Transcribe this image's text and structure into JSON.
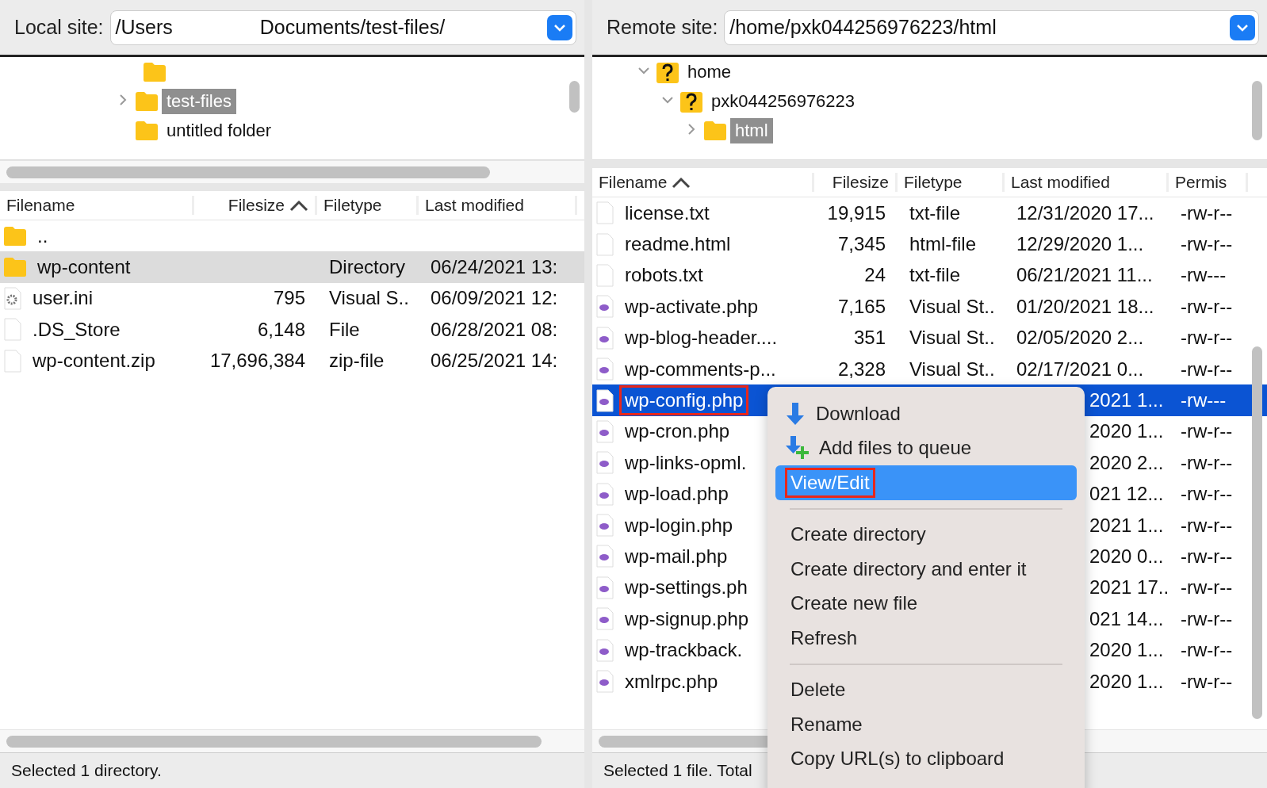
{
  "local": {
    "label": "Local site:",
    "path_start": "/Users",
    "path_end": "Documents/test-files/",
    "tree": [
      {
        "label": "test-files",
        "selected": true,
        "expanded": false
      },
      {
        "label": "untitled folder",
        "selected": false
      }
    ],
    "columns": [
      {
        "label": "Filename",
        "sorted": false
      },
      {
        "label": "Filesize",
        "sorted": true
      },
      {
        "label": "Filetype",
        "sorted": false
      },
      {
        "label": "Last modified",
        "sorted": false
      }
    ],
    "rows": [
      {
        "kind": "folder",
        "name": "..",
        "selected": false
      },
      {
        "kind": "folder",
        "name": "wp-content",
        "type": "Directory",
        "modified": "06/24/2021 13:",
        "selected": true
      },
      {
        "kind": "config",
        "name": "user.ini",
        "size": "795",
        "type": "Visual S..",
        "modified": "06/09/2021 12:",
        "selected": false
      },
      {
        "kind": "file",
        "name": ".DS_Store",
        "size": "6,148",
        "type": "File",
        "modified": "06/28/2021 08:",
        "selected": false
      },
      {
        "kind": "file",
        "name": "wp-content.zip",
        "size": "17,696,384",
        "type": "zip-file",
        "modified": "06/25/2021 14:",
        "selected": false
      }
    ],
    "status": "Selected 1 directory."
  },
  "remote": {
    "label": "Remote site:",
    "path": "/home/pxk044256976223/html",
    "tree": [
      {
        "label": "home",
        "kind": "unknown",
        "selected": false,
        "expanded": true,
        "children": [
          {
            "label": "pxk044256976223",
            "kind": "unknown",
            "selected": false,
            "expanded": true,
            "children": [
              {
                "label": "html",
                "selected": true,
                "expanded": false
              }
            ]
          }
        ]
      }
    ],
    "columns": [
      {
        "label": "Filename",
        "sorted": true
      },
      {
        "label": "Filesize",
        "sorted": false
      },
      {
        "label": "Filetype",
        "sorted": false
      },
      {
        "label": "Last modified",
        "sorted": false
      },
      {
        "label": "Permis",
        "sorted": false
      }
    ],
    "rows": [
      {
        "kind": "file",
        "name": "license.txt",
        "size": "19,915",
        "type": "txt-file",
        "modified": "12/31/2020 17...",
        "permissions": "-rw-r--",
        "selected": false,
        "highlighted": false
      },
      {
        "kind": "file",
        "name": "readme.html",
        "size": "7,345",
        "type": "html-file",
        "modified": "12/29/2020 1...",
        "permissions": "-rw-r--",
        "selected": false,
        "highlighted": false
      },
      {
        "kind": "file",
        "name": "robots.txt",
        "size": "24",
        "type": "txt-file",
        "modified": "06/21/2021 11...",
        "permissions": "-rw---",
        "selected": false,
        "highlighted": false
      },
      {
        "kind": "php",
        "name": "wp-activate.php",
        "size": "7,165",
        "type": "Visual St..",
        "modified": "01/20/2021 18...",
        "permissions": "-rw-r--",
        "selected": false,
        "highlighted": false
      },
      {
        "kind": "php",
        "name": "wp-blog-header....",
        "size": "351",
        "type": "Visual St..",
        "modified": "02/05/2020 2...",
        "permissions": "-rw-r--",
        "selected": false,
        "highlighted": false
      },
      {
        "kind": "php",
        "name": "wp-comments-p...",
        "size": "2,328",
        "type": "Visual St..",
        "modified": "02/17/2021 0...",
        "permissions": "-rw-r--",
        "selected": false,
        "highlighted": false
      },
      {
        "kind": "php",
        "name": "wp-config.php",
        "modified": "2021 1...",
        "permissions": "-rw---",
        "selected": true,
        "highlighted": true
      },
      {
        "kind": "php",
        "name": "wp-cron.php",
        "modified": "2020 1...",
        "permissions": "-rw-r--",
        "selected": false,
        "highlighted": false
      },
      {
        "kind": "php",
        "name": "wp-links-opml.",
        "modified": "2020 2...",
        "permissions": "-rw-r--",
        "selected": false,
        "highlighted": false
      },
      {
        "kind": "php",
        "name": "wp-load.php",
        "modified": "021 12...",
        "permissions": "-rw-r--",
        "selected": false,
        "highlighted": false
      },
      {
        "kind": "php",
        "name": "wp-login.php",
        "modified": "2021 1...",
        "permissions": "-rw-r--",
        "selected": false,
        "highlighted": false
      },
      {
        "kind": "php",
        "name": "wp-mail.php",
        "modified": "2020 0...",
        "permissions": "-rw-r--",
        "selected": false,
        "highlighted": false
      },
      {
        "kind": "php",
        "name": "wp-settings.ph",
        "modified": "2021 17...",
        "permissions": "-rw-r--",
        "selected": false,
        "highlighted": false
      },
      {
        "kind": "php",
        "name": "wp-signup.php",
        "modified": "021 14...",
        "permissions": "-rw-r--",
        "selected": false,
        "highlighted": false
      },
      {
        "kind": "php",
        "name": "wp-trackback.",
        "modified": "2020 1...",
        "permissions": "-rw-r--",
        "selected": false,
        "highlighted": false
      },
      {
        "kind": "php",
        "name": "xmlrpc.php",
        "modified": "2020 1...",
        "permissions": "-rw-r--",
        "selected": false,
        "highlighted": false
      }
    ],
    "status": "Selected 1 file. Total"
  },
  "context_menu": [
    {
      "kind": "download",
      "label": "Download",
      "selected": false,
      "highlighted": false
    },
    {
      "kind": "queue",
      "label": "Add files to queue",
      "selected": false,
      "highlighted": false
    },
    {
      "kind": "plain",
      "label": "View/Edit",
      "selected": true,
      "highlighted": true
    },
    {
      "kind": "separator"
    },
    {
      "kind": "plain",
      "label": "Create directory",
      "selected": false,
      "highlighted": false
    },
    {
      "kind": "plain",
      "label": "Create directory and enter it",
      "selected": false,
      "highlighted": false
    },
    {
      "kind": "plain",
      "label": "Create new file",
      "selected": false,
      "highlighted": false
    },
    {
      "kind": "plain",
      "label": "Refresh",
      "selected": false,
      "highlighted": false
    },
    {
      "kind": "separator"
    },
    {
      "kind": "plain",
      "label": "Delete",
      "selected": false,
      "highlighted": false
    },
    {
      "kind": "plain",
      "label": "Rename",
      "selected": false,
      "highlighted": false
    },
    {
      "kind": "plain",
      "label": "Copy URL(s) to clipboard",
      "selected": false,
      "highlighted": false
    }
  ]
}
